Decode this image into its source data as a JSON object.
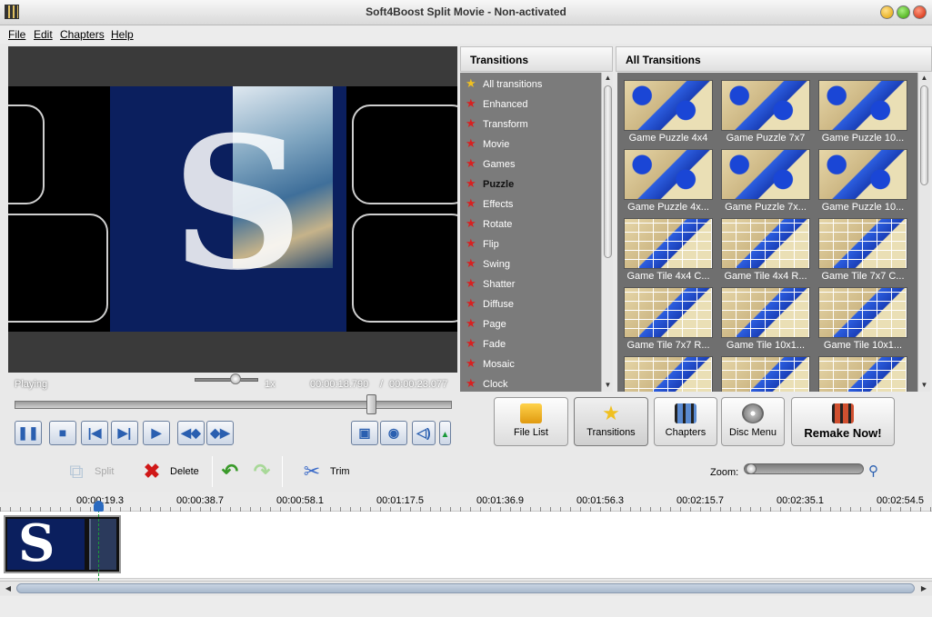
{
  "window": {
    "title": "Soft4Boost Split Movie - Non-activated"
  },
  "menu": [
    "File",
    "Edit",
    "Chapters",
    "Help"
  ],
  "player": {
    "status": "Playing",
    "speed": "1x",
    "time_current": "00:00:18.790",
    "time_separator": "/",
    "time_total": "00:00:23.077",
    "seek_position": 0.82
  },
  "transitions": {
    "header": "Transitions",
    "categories": [
      {
        "label": "All transitions",
        "icon": "gold-star-icon"
      },
      {
        "label": "Enhanced",
        "icon": "red-star-icon"
      },
      {
        "label": "Transform",
        "icon": "red-star-icon"
      },
      {
        "label": "Movie",
        "icon": "red-star-icon"
      },
      {
        "label": "Games",
        "icon": "red-star-icon"
      },
      {
        "label": "Puzzle",
        "icon": "red-star-icon"
      },
      {
        "label": "Effects",
        "icon": "red-star-icon"
      },
      {
        "label": "Rotate",
        "icon": "red-star-icon"
      },
      {
        "label": "Flip",
        "icon": "red-star-icon"
      },
      {
        "label": "Swing",
        "icon": "red-star-icon"
      },
      {
        "label": "Shatter",
        "icon": "red-star-icon"
      },
      {
        "label": "Diffuse",
        "icon": "red-star-icon"
      },
      {
        "label": "Page",
        "icon": "red-star-icon"
      },
      {
        "label": "Fade",
        "icon": "red-star-icon"
      },
      {
        "label": "Mosaic",
        "icon": "red-star-icon"
      },
      {
        "label": "Clock",
        "icon": "red-star-icon"
      }
    ],
    "active_category": "Puzzle"
  },
  "all_transitions": {
    "header": "All Transitions",
    "items": [
      "Game Puzzle 4x4",
      "Game Puzzle 7x7",
      "Game Puzzle 10...",
      "Game Puzzle 4x...",
      "Game Puzzle 7x...",
      "Game Puzzle 10...",
      "Game Tile 4x4 C...",
      "Game Tile 4x4 R...",
      "Game Tile 7x7 C...",
      "Game Tile 7x7 R...",
      "Game Tile 10x1...",
      "Game Tile 10x1...",
      "",
      "",
      ""
    ]
  },
  "main_buttons": {
    "file_list": "File List",
    "transitions": "Transitions",
    "chapters": "Chapters",
    "disc_menu": "Disc Menu",
    "remake": "Remake Now!"
  },
  "toolbar": {
    "split": "Split",
    "delete": "Delete",
    "trim": "Trim",
    "zoom_label": "Zoom:"
  },
  "timeline": {
    "ticks": [
      "00:00:19.3",
      "00:00:38.7",
      "00:00:58.1",
      "00:01:17.5",
      "00:01:36.9",
      "00:01:56.3",
      "00:02:15.7",
      "00:02:35.1",
      "00:02:54.5"
    ]
  },
  "colors": {
    "accent_blue": "#2a5fb0",
    "list_bg": "#7b7b7b",
    "grid_bg": "#6f6f6f",
    "playhead": "#1a9a3a"
  }
}
